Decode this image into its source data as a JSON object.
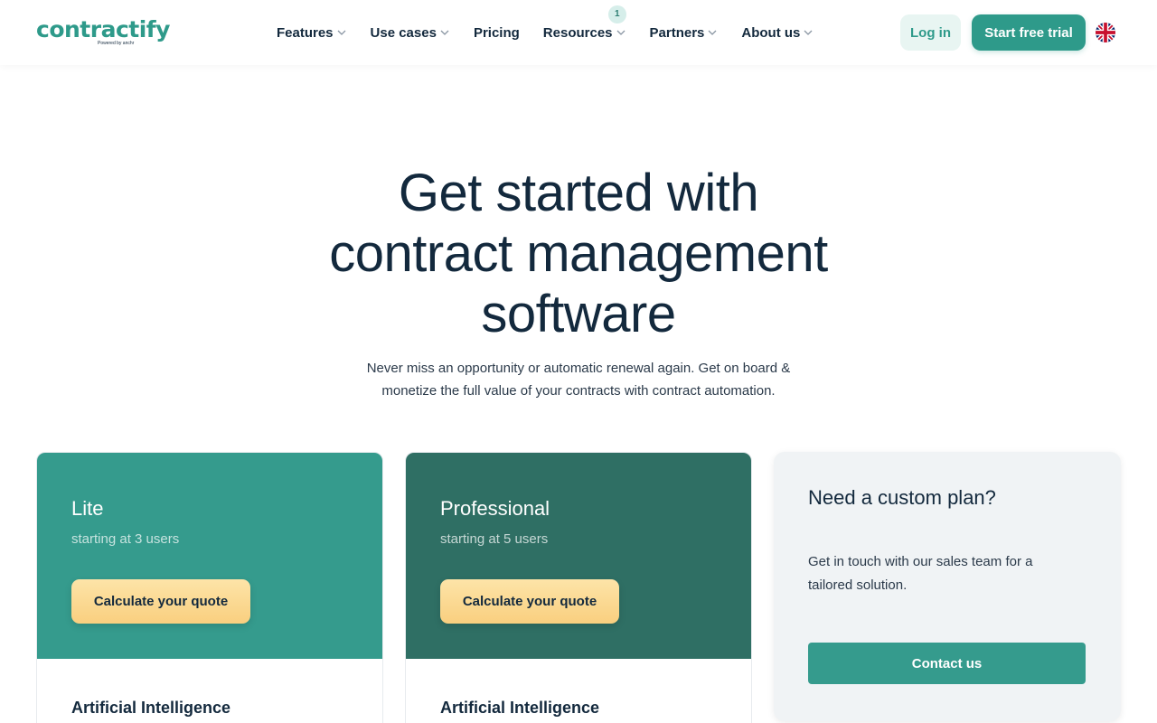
{
  "brand": {
    "name": "contractify",
    "tagline": "Powered by anchr",
    "color": "#2e9a8a"
  },
  "nav": {
    "items": [
      {
        "label": "Features",
        "dropdown": true
      },
      {
        "label": "Use cases",
        "dropdown": true
      },
      {
        "label": "Pricing",
        "dropdown": false
      },
      {
        "label": "Resources",
        "dropdown": true,
        "badge": "1"
      },
      {
        "label": "Partners",
        "dropdown": true
      },
      {
        "label": "About us",
        "dropdown": true
      }
    ],
    "login_label": "Log in",
    "trial_label": "Start free trial",
    "language_icon": "uk-flag-icon"
  },
  "hero": {
    "title_line1": "Get started with",
    "title_line2": "contract management",
    "title_line3": "software",
    "subtitle_line1": "Never miss an opportunity or automatic renewal again. Get on board &",
    "subtitle_line2": "monetize the full value of your contracts with contract automation."
  },
  "plans": [
    {
      "name": "Lite",
      "users": "starting at 3 users",
      "cta": "Calculate your quote",
      "feature_heading": "Artificial Intelligence",
      "color": "#359b8d"
    },
    {
      "name": "Professional",
      "users": "starting at 5 users",
      "cta": "Calculate your quote",
      "feature_heading": "Artificial Intelligence",
      "color": "#2f6f64"
    }
  ],
  "custom_plan": {
    "title": "Need a custom plan?",
    "text": "Get in touch with our sales team for a tailored solution.",
    "cta": "Contact us"
  }
}
